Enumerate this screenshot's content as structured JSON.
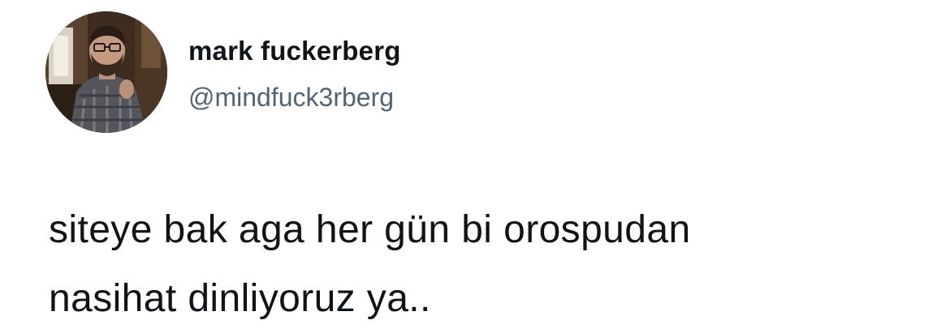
{
  "author": {
    "display_name": "mark fuckerberg",
    "handle": "@mindfuck3rberg",
    "avatar_icon": "profile-photo"
  },
  "tweet": {
    "lines": [
      "siteye bak aga her gün bi orospudan",
      "nasihat dinliyoruz ya.."
    ]
  },
  "colors": {
    "text": "#0f1419",
    "handle": "#536471",
    "background": "#ffffff"
  }
}
